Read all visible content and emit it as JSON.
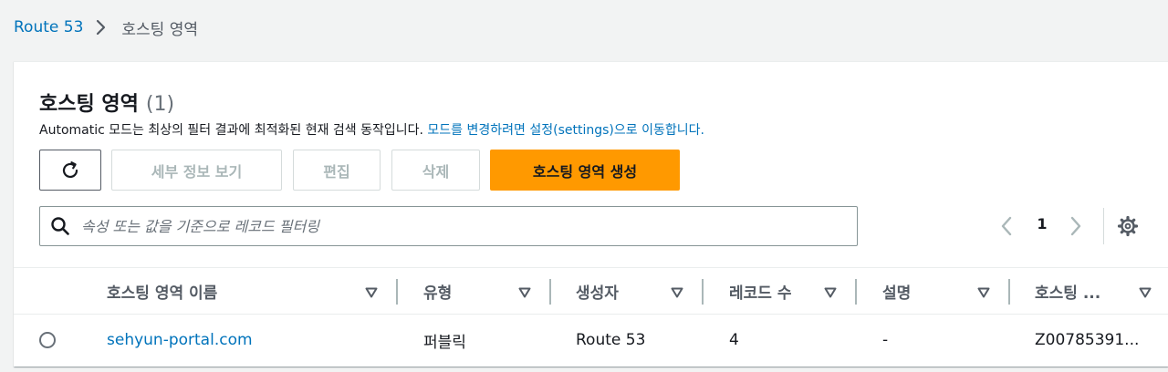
{
  "breadcrumb": {
    "parent": "Route 53",
    "current": "호스팅 영역"
  },
  "panel": {
    "title": "호스팅 영역",
    "count": "(1)",
    "description_text": "Automatic 모드는 최상의 필터 결과에 최적화된 현재 검색 동작입니다. ",
    "description_link": "모드를 변경하려면 설정(settings)으로 이동합니다."
  },
  "toolbar": {
    "refresh_icon": "refresh-icon",
    "details_label": "세부 정보 보기",
    "edit_label": "편집",
    "delete_label": "삭제",
    "create_label": "호스팅 영역 생성"
  },
  "search": {
    "placeholder": "속성 또는 값을 기준으로 레코드 필터링"
  },
  "pagination": {
    "current_page": "1"
  },
  "table": {
    "columns": [
      "호스팅 영역 이름",
      "유형",
      "생성자",
      "레코드 수",
      "설명",
      "호스팅 ..."
    ],
    "rows": [
      {
        "name": "sehyun-portal.com",
        "type": "퍼블릭",
        "created_by": "Route 53",
        "record_count": "4",
        "description": "-",
        "hosted_zone_id": "Z00785391..."
      }
    ]
  },
  "colors": {
    "link": "#0073bb",
    "primary": "#ff9900",
    "disabled_text": "#aab7b8"
  }
}
